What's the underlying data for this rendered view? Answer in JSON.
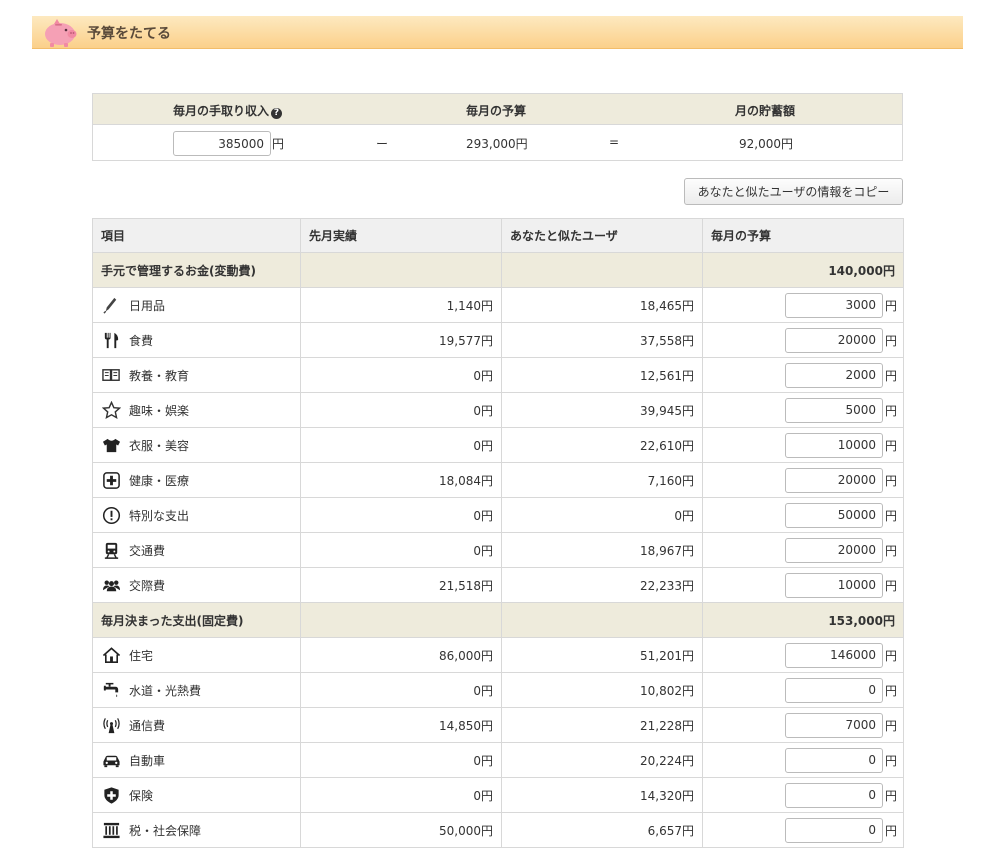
{
  "header": {
    "title": "予算をたてる"
  },
  "summary": {
    "income_label": "毎月の手取り収入",
    "budget_label": "毎月の予算",
    "savings_label": "月の貯蓄額",
    "income_value": "385000",
    "yen": "円",
    "minus": "ー",
    "equals": "=",
    "budget_value": "293,000円",
    "savings_value": "92,000円"
  },
  "copy_button": "あなたと似たユーザの情報をコピー",
  "table": {
    "headers": [
      "項目",
      "先月実績",
      "あなたと似たユーザ",
      "毎月の予算"
    ],
    "variable": {
      "label": "手元で管理するお金(変動費)",
      "total": "140,000円",
      "items": [
        {
          "icon": "pencil-icon",
          "name": "日用品",
          "last": "1,140円",
          "similar": "18,465円",
          "budget": "3000"
        },
        {
          "icon": "fork-knife-icon",
          "name": "食費",
          "last": "19,577円",
          "similar": "37,558円",
          "budget": "20000"
        },
        {
          "icon": "book-icon",
          "name": "教養・教育",
          "last": "0円",
          "similar": "12,561円",
          "budget": "2000"
        },
        {
          "icon": "star-icon",
          "name": "趣味・娯楽",
          "last": "0円",
          "similar": "39,945円",
          "budget": "5000"
        },
        {
          "icon": "shirt-icon",
          "name": "衣服・美容",
          "last": "0円",
          "similar": "22,610円",
          "budget": "10000"
        },
        {
          "icon": "medical-cross-icon",
          "name": "健康・医療",
          "last": "18,084円",
          "similar": "7,160円",
          "budget": "20000"
        },
        {
          "icon": "exclamation-icon",
          "name": "特別な支出",
          "last": "0円",
          "similar": "0円",
          "budget": "50000"
        },
        {
          "icon": "train-icon",
          "name": "交通費",
          "last": "0円",
          "similar": "18,967円",
          "budget": "20000"
        },
        {
          "icon": "people-icon",
          "name": "交際費",
          "last": "21,518円",
          "similar": "22,233円",
          "budget": "10000"
        }
      ]
    },
    "fixed": {
      "label": "毎月決まった支出(固定費)",
      "total": "153,000円",
      "items": [
        {
          "icon": "house-icon",
          "name": "住宅",
          "last": "86,000円",
          "similar": "51,201円",
          "budget": "146000"
        },
        {
          "icon": "faucet-icon",
          "name": "水道・光熱費",
          "last": "0円",
          "similar": "10,802円",
          "budget": "0"
        },
        {
          "icon": "antenna-icon",
          "name": "通信費",
          "last": "14,850円",
          "similar": "21,228円",
          "budget": "7000"
        },
        {
          "icon": "car-icon",
          "name": "自動車",
          "last": "0円",
          "similar": "20,224円",
          "budget": "0"
        },
        {
          "icon": "shield-icon",
          "name": "保険",
          "last": "0円",
          "similar": "14,320円",
          "budget": "0"
        },
        {
          "icon": "building-icon",
          "name": "税・社会保障",
          "last": "50,000円",
          "similar": "6,657円",
          "budget": "0"
        }
      ]
    }
  },
  "colors": {
    "header_gradient_top": "#fde9c0",
    "header_gradient_bottom": "#fbd08a",
    "category_bg": "#eeebdc",
    "table_head_bg": "#f0f0f0"
  }
}
